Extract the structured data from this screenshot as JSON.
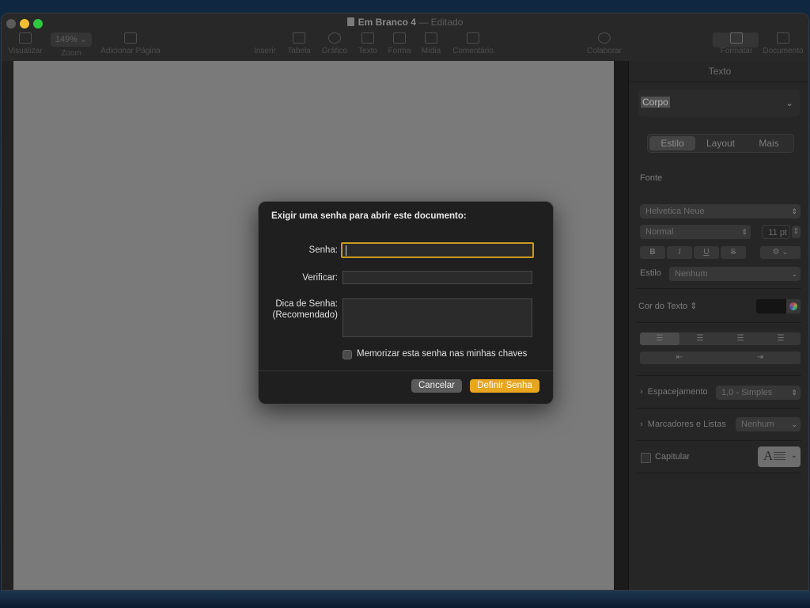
{
  "window": {
    "title": "Em Branco 4",
    "title_sep": "—",
    "state": "Editado"
  },
  "toolbar": {
    "visualizar": "Visualizar",
    "zoom_value": "149%",
    "zoom": "Zoom",
    "adicionar_pagina": "Adicionar Página",
    "inserir": "Inserir",
    "tabela": "Tabela",
    "grafico": "Gráfico",
    "texto": "Texto",
    "forma": "Forma",
    "midia": "Mídia",
    "comentario": "Comentário",
    "colaborar": "Colaborar",
    "formatar": "Formatar",
    "documento": "Documento"
  },
  "inspector": {
    "title": "Texto",
    "paragraph_style": "Corpo",
    "tabs": [
      "Estilo",
      "Layout",
      "Mais"
    ],
    "fonte_label": "Fonte",
    "font_family": "Helvetica Neue",
    "font_typeface": "Normal",
    "font_size": "11 pt",
    "bold": "B",
    "italic": "I",
    "underline": "U",
    "strike": "S",
    "estilo_label": "Estilo",
    "estilo_value": "Nenhum",
    "cor_label": "Cor do Texto",
    "espacamento_label": "Espacejamento",
    "espacamento_value": "1,0 - Simples",
    "marcadores_label": "Marcadores e Listas",
    "marcadores_value": "Nenhum",
    "capitular_label": "Capitular"
  },
  "dialog": {
    "title": "Exigir uma senha para abrir este documento:",
    "senha_label": "Senha:",
    "verificar_label": "Verificar:",
    "dica_label_1": "Dica de Senha:",
    "dica_label_2": "(Recomendado)",
    "remember_label": "Memorizar esta senha nas minhas chaves",
    "cancel": "Cancelar",
    "confirm": "Definir Senha"
  },
  "colors": {
    "accent": "#e8a51e",
    "focus_ring": "#c99a1f",
    "page": "#7a7a7a"
  }
}
